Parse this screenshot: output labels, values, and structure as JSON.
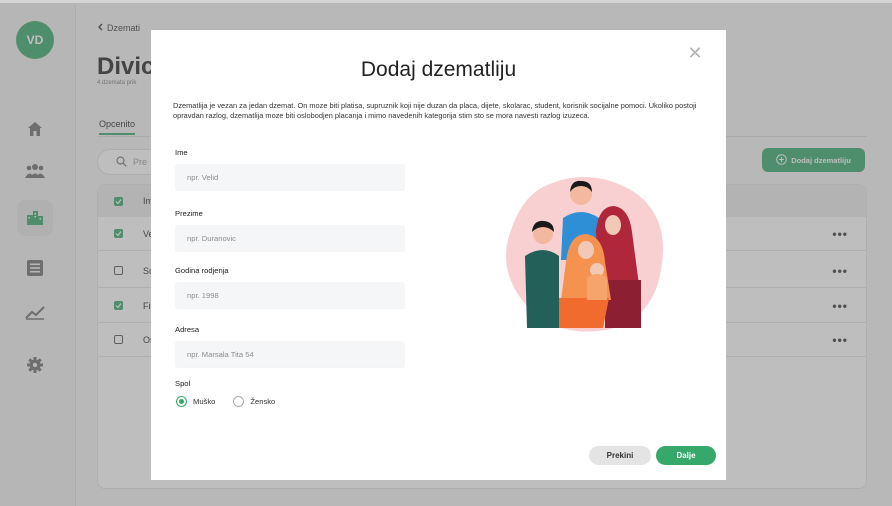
{
  "user": {
    "initials": "VD"
  },
  "sidebar": {
    "icons": [
      "home-icon",
      "users-icon",
      "buildings-icon",
      "list-icon",
      "chart-icon",
      "gear-icon"
    ],
    "accent": "#35a86a"
  },
  "page": {
    "breadcrumb": "Dzemati",
    "title": "Divic",
    "subtitle": "4 dzemata prik",
    "tab": "Opcenito",
    "search_placeholder": "Pre",
    "add_button": "Dodaj dzematliju",
    "table": {
      "header": "Im",
      "rows": [
        {
          "text": "Ve",
          "checked": true
        },
        {
          "text": "Su",
          "checked": false
        },
        {
          "text": "Fi",
          "checked": true
        },
        {
          "text": "Os",
          "checked": false
        }
      ]
    }
  },
  "modal": {
    "title": "Dodaj dzematliju",
    "description": "Dzematlija je vezan za jedan dzemat. On moze biti platisa, supruznik koji nije duzan da placa, dijete, skolarac, student, korisnik socijalne pomoci. Ukoliko postoji opravdan razlog, dzematlija moze biti oslobodjen placanja i mimo navedenih kategorija stim sto se mora navesti razlog izuzeca.",
    "fields": {
      "ime": {
        "label": "Ime",
        "placeholder": "npr. Velid",
        "value": ""
      },
      "prezime": {
        "label": "Prezime",
        "placeholder": "npr. Duranovic",
        "value": ""
      },
      "godina": {
        "label": "Godina rodjenja",
        "placeholder": "npr. 1998",
        "value": ""
      },
      "adresa": {
        "label": "Adresa",
        "placeholder": "npr. Marsala Tita 54",
        "value": ""
      }
    },
    "gender": {
      "label": "Spol",
      "options": [
        "Muško",
        "Žensko"
      ],
      "selected": "Muško"
    },
    "buttons": {
      "cancel": "Prekini",
      "next": "Dalje"
    },
    "close_icon": "close-icon"
  }
}
